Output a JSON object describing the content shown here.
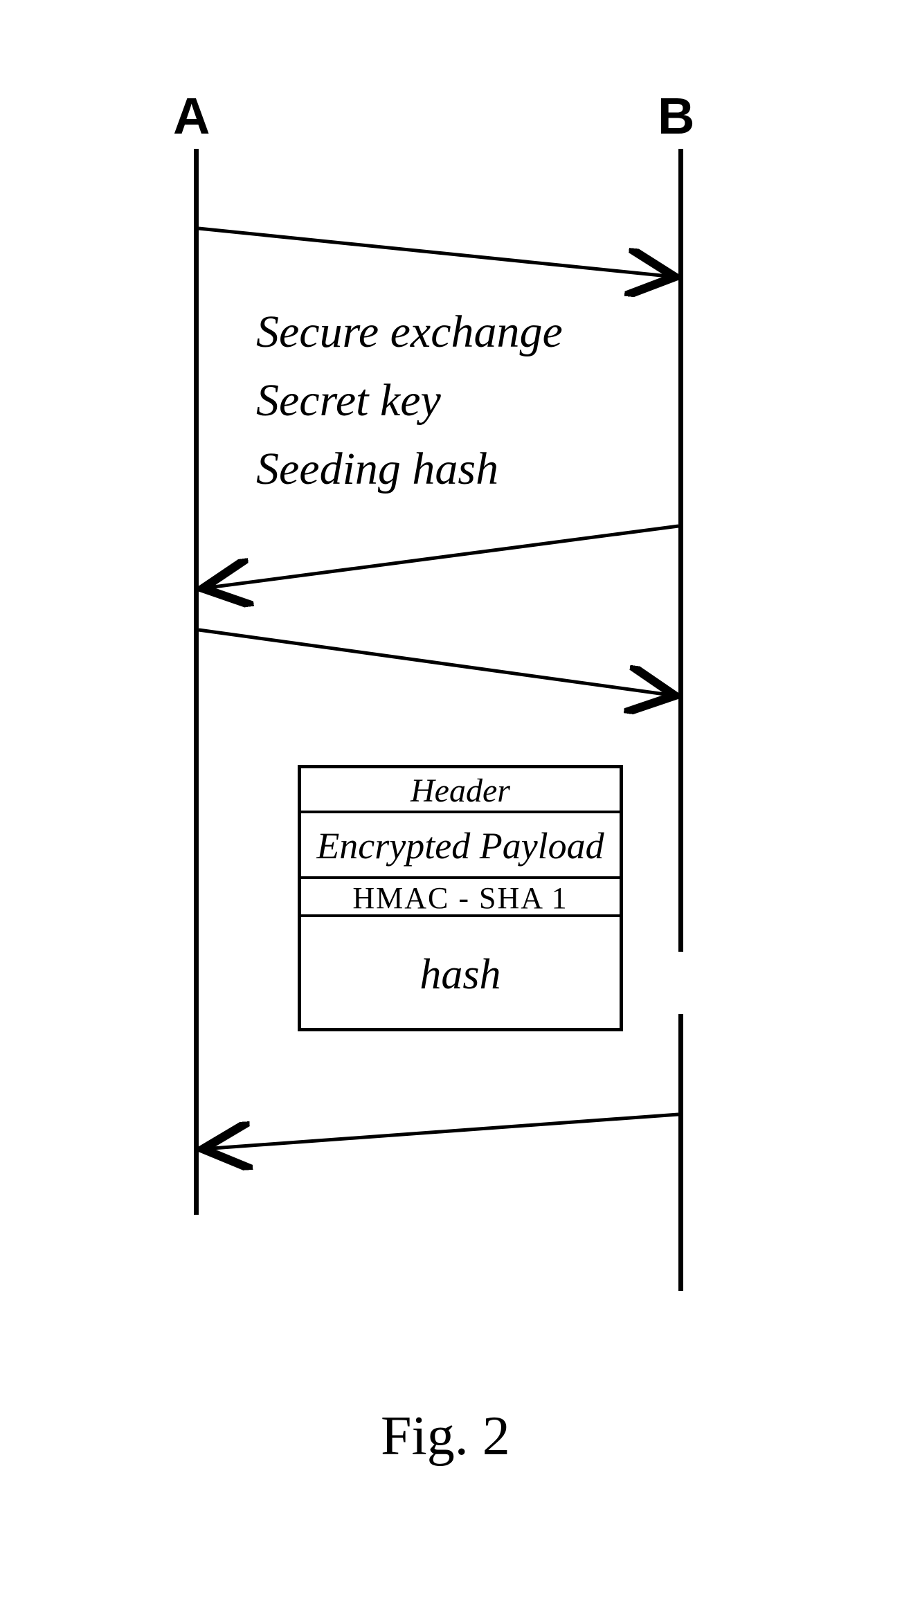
{
  "participants": {
    "a": "A",
    "b": "B"
  },
  "exchange": {
    "line1": "Secure exchange",
    "line2": "Secret key",
    "line3": "Seeding hash"
  },
  "packet": {
    "header": "Header",
    "payload": "Encrypted Payload",
    "hmac": "HMAC - SHA 1",
    "hash": "hash"
  },
  "figure_label": "Fig. 2"
}
